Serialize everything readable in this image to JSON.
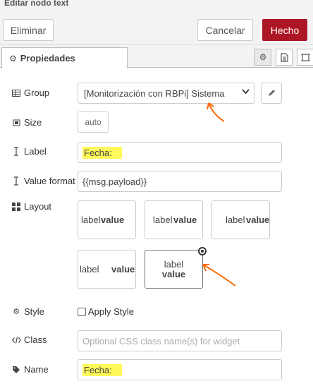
{
  "dialog": {
    "title": "Editar nodo text"
  },
  "toolbar": {
    "delete_label": "Eliminar",
    "cancel_label": "Cancelar",
    "done_label": "Hecho"
  },
  "tabs": {
    "properties_label": "Propiedades"
  },
  "form": {
    "group": {
      "label": "Group",
      "value": "[Monitorización con RBPi] Sistema"
    },
    "size": {
      "label": "Size",
      "value": "auto"
    },
    "label_field": {
      "label": "Label",
      "value": "Fecha:"
    },
    "value_format": {
      "label": "Value format",
      "value": "{{msg.payload}}"
    },
    "layout": {
      "label": "Layout",
      "options": [
        {
          "label": "label",
          "value": "value"
        },
        {
          "label": "label",
          "value": "value"
        },
        {
          "label": "label",
          "value": "value"
        },
        {
          "label": "label",
          "value": "value"
        },
        {
          "label": "label",
          "value": "value"
        }
      ],
      "selected_index": 4
    },
    "style": {
      "label": "Style",
      "checkbox_label": "Apply Style",
      "checked": false
    },
    "class_field": {
      "label": "Class",
      "placeholder": "Optional CSS class name(s) for widget"
    },
    "name": {
      "label": "Name",
      "value": "Fecha:"
    }
  },
  "annotations": {
    "highlight_color": "#fff95a",
    "arrow_color": "#ff6a00"
  },
  "colors": {
    "primary_button": "#ad1625"
  }
}
